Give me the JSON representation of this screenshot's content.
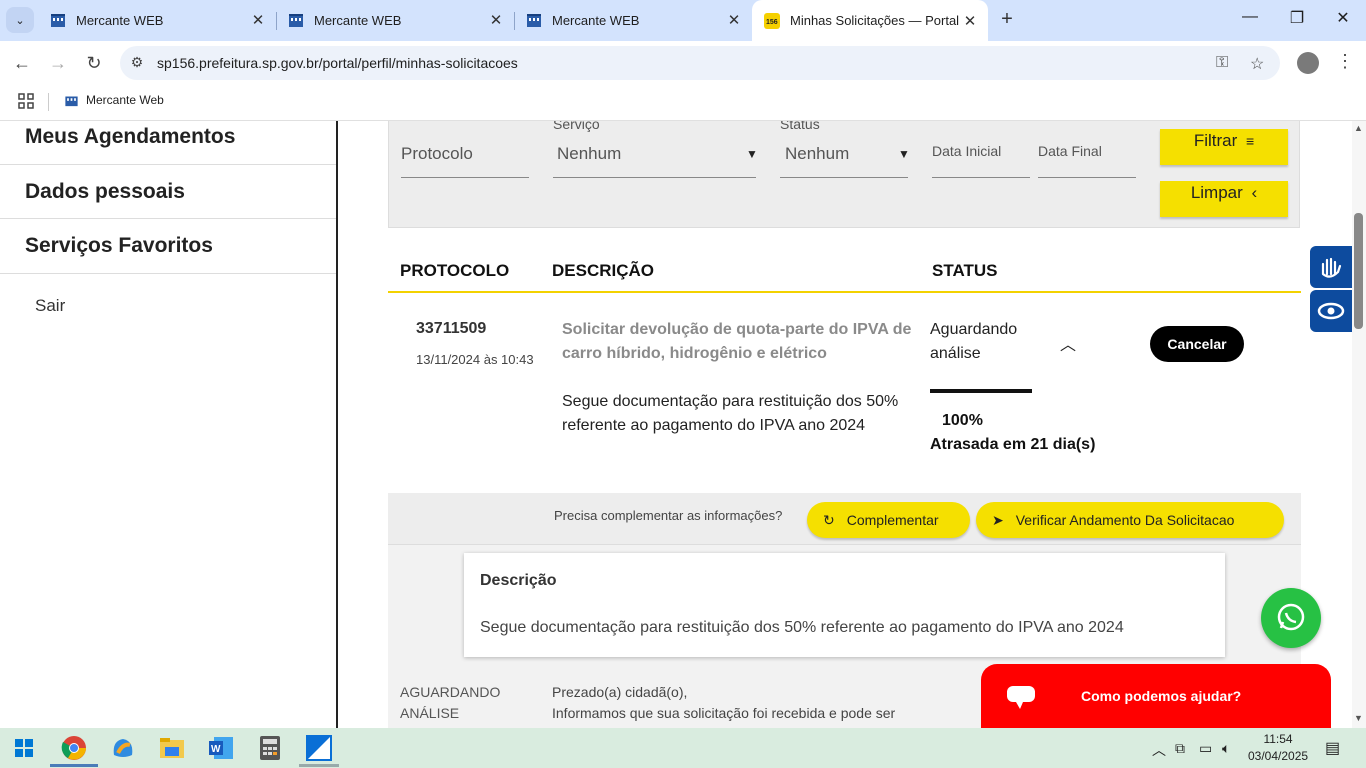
{
  "browser": {
    "tabs": [
      {
        "title": "Mercante WEB"
      },
      {
        "title": "Mercante WEB"
      },
      {
        "title": "Mercante WEB"
      },
      {
        "title": "Minhas Solicitações — Portal"
      }
    ],
    "url": "sp156.prefeitura.sp.gov.br/portal/perfil/minhas-solicitacoes",
    "bookmark": "Mercante Web"
  },
  "sidebar": {
    "items": [
      "Meus Agendamentos",
      "Dados pessoais",
      "Serviços Favoritos"
    ],
    "logout": "Sair"
  },
  "filter": {
    "protocolo_placeholder": "Protocolo",
    "servico_label": "Serviço",
    "servico_value": "Nenhum",
    "status_label": "Status",
    "status_value": "Nenhum",
    "data_inicial": "Data Inicial",
    "data_final": "Data Final",
    "filtrar": "Filtrar",
    "limpar": "Limpar"
  },
  "table": {
    "headers": [
      "PROTOCOLO",
      "DESCRIÇÃO",
      "STATUS"
    ],
    "row": {
      "protocolo": "33711509",
      "data": "13/11/2024 às 10:43",
      "titulo": "Solicitar devolução de quota-parte do IPVA de carro híbrido, hidrogênio e elétrico",
      "texto": "Segue documentação para restituição dos 50% referente ao pagamento do IPVA ano 2024",
      "status": "Aguardando análise",
      "progress": 1.0,
      "percent": "100%",
      "atraso": "Atrasada em 21 dia(s)",
      "cancelar": "Cancelar"
    }
  },
  "actions": {
    "question": "Precisa complementar as informações?",
    "complementar": "Complementar",
    "verificar": "Verificar Andamento Da Solicitacao"
  },
  "detail": {
    "heading": "Descrição",
    "text": "Segue documentação para restituição dos 50% referente ao pagamento do IPVA ano 2024"
  },
  "history": {
    "stage_line1": "AGUARDANDO",
    "stage_line2": "ANÁLISE",
    "msg_line1": "Prezado(a) cidadã(o),",
    "msg_line2": "Informamos que sua solicitação foi recebida e pode ser"
  },
  "chat": {
    "label": "Como podemos ajudar?"
  },
  "taskbar": {
    "time": "11:54",
    "date": "03/04/2025"
  },
  "colors": {
    "accent_yellow": "#f5e000",
    "chat_red": "#ff0000",
    "whatsapp": "#27c144",
    "a11y_blue": "#0d4b9e"
  }
}
